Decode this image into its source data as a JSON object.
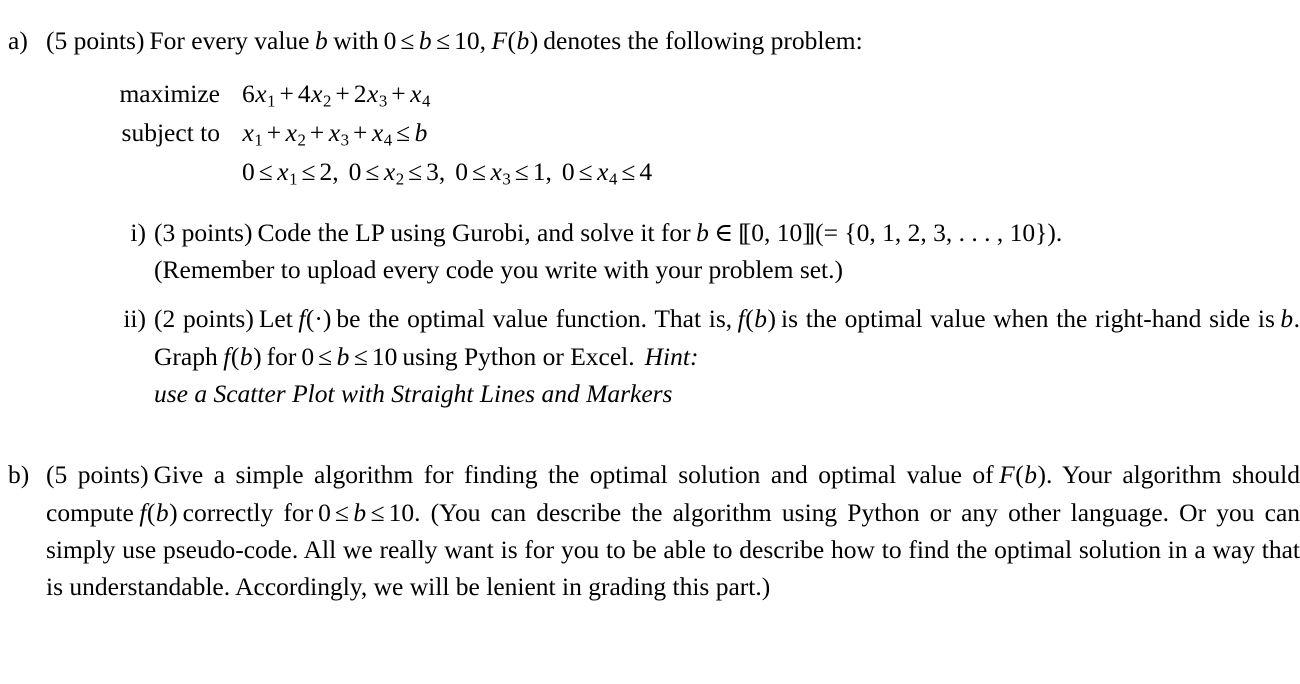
{
  "document": {
    "type": "homework-problem-statement",
    "parts": [
      {
        "label": "a)",
        "points": "(5 points)",
        "intro_before_math": "For every value",
        "intro_var": "b",
        "intro_mid": "with",
        "intro_range": "0 ≤ b ≤ 10,",
        "intro_func": "F(b)",
        "intro_after": "denotes the following problem:",
        "math": {
          "objective_label": "maximize",
          "objective_expr": "6x₁ + 4x₂ + 2x₃ + x₄",
          "constraint_label": "subject to",
          "constraint_expr": "x₁ + x₂ + x₃ + x₄ ≤ b",
          "bounds_expr": "0 ≤ x₁ ≤ 2, 0 ≤ x₂ ≤ 3, 0 ≤ x₃ ≤ 1, 0 ≤ x₄ ≤ 4",
          "coefficients": [
            6,
            4,
            2,
            1
          ],
          "upper_bounds": [
            2,
            3,
            1,
            4
          ],
          "rhs_symbol": "b",
          "rhs_range": [
            0,
            10
          ]
        },
        "subitems": [
          {
            "label": "i)",
            "points": "(3 points)",
            "text_1": "Code the LP using Gurobi, and solve it for",
            "text_var": "b",
            "text_in": "∈",
            "text_set_bracket": "⟦0, 10⟧",
            "text_set_expansion": "(= {0, 1, 2, 3, … , 10}).",
            "text_2": "(Remember to upload every code you write with your problem set.)"
          },
          {
            "label": "ii)",
            "points": "(2 points)",
            "text_1": "Let",
            "text_f": "f(·)",
            "text_2": "be the optimal value function. That is,",
            "text_fb": "f(b)",
            "text_3": "is the optimal value when the right-hand side is",
            "text_b": "b",
            "text_4": ". Graph",
            "text_fb2": "f(b)",
            "text_5": "for",
            "text_range": "0 ≤ b ≤ 10",
            "text_6": "using Python or Excel.",
            "hint_label": "Hint:",
            "hint_text": "use a Scatter Plot with Straight Lines and Markers"
          }
        ]
      },
      {
        "label": "b)",
        "points": "(5 points)",
        "text_1": "Give a simple algorithm for finding the optimal solution and optimal value of",
        "text_Fb": "F(b)",
        "text_2": ". Your algorithm should compute",
        "text_fb": "f(b)",
        "text_3": "correctly for",
        "text_range": "0 ≤ b ≤ 10",
        "text_4": ". (You can describe the algorithm using Python or any other language. Or you can simply use pseudo-code. All we really want is for you to be able to describe how to find the optimal solution in a way that is understandable. Accordingly, we will be lenient in grading this part.)"
      }
    ]
  }
}
